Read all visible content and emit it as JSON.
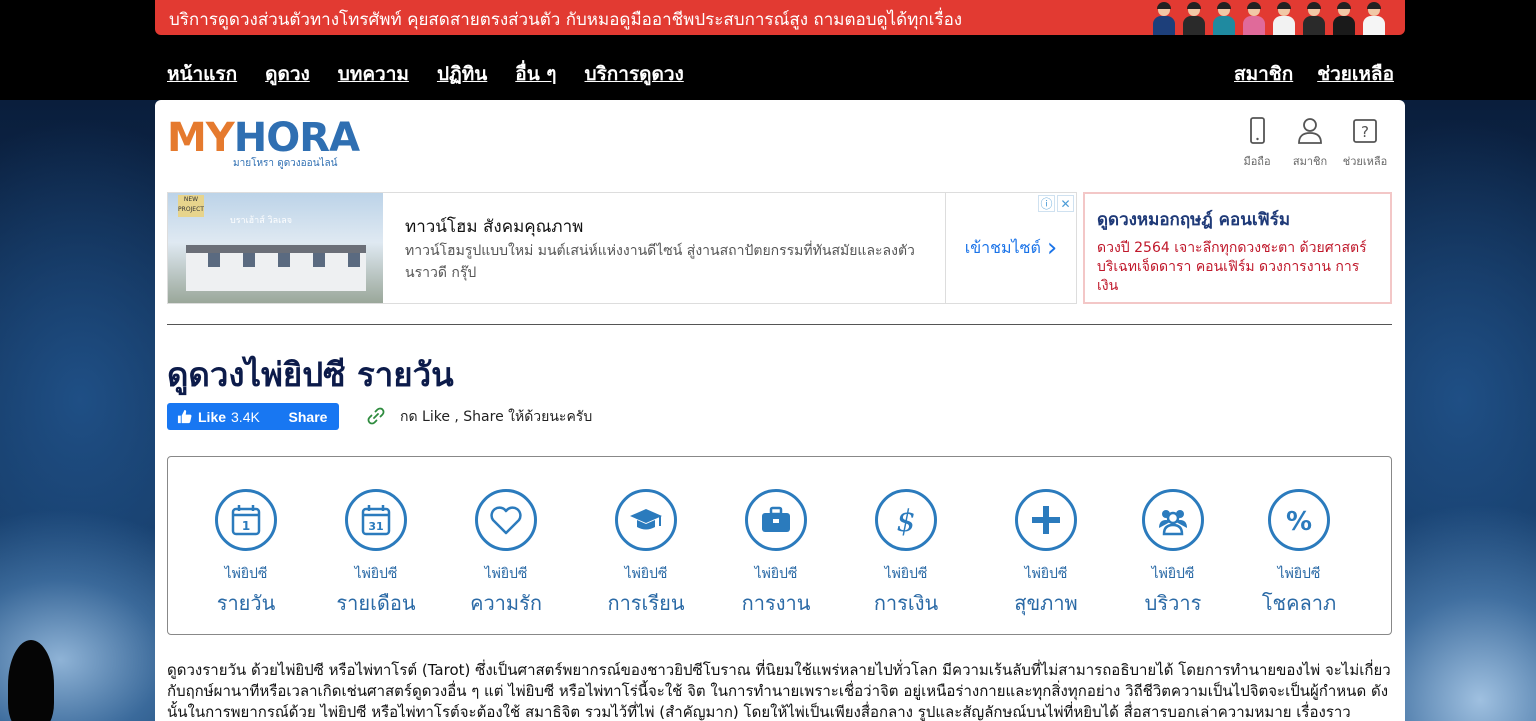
{
  "promo": {
    "text": "บริการดูดวงส่วนตัวทางโทรศัพท์ คุยสดสายตรงส่วนตัว กับหมอดูมืออาชีพประสบการณ์สูง ถามตอบดูได้ทุกเรื่อง",
    "accent": "#e23a32"
  },
  "nav": {
    "left": [
      "หน้าแรก",
      "ดูดวง",
      "บทความ",
      "ปฏิทิน",
      "อื่น ๆ",
      "บริการดูดวง"
    ],
    "right": [
      "สมาชิก",
      "ช่วยเหลือ"
    ]
  },
  "logo": {
    "my": "MY",
    "hora": "HORA",
    "sub": "มายโหรา ดูดวงออนไลน์"
  },
  "utility": {
    "mobile": "มือถือ",
    "member": "สมาชิก",
    "help": "ช่วยเหลือ"
  },
  "ad": {
    "thumb_badge": "NEW PROJECT",
    "thumb_title": "บราเฮ้าส์ วิลเลจ",
    "title": "ทาวน์โฮม สังคมคุณภาพ",
    "desc": "ทาวน์โฮมรูปแบบใหม่ มนต์เสน่ห์แห่งงานดีไซน์ สู่งานสถาปัตยกรรมที่ทันสมัยและลงตัว นราวดี กรุ๊ป",
    "cta": "เข้าชมไซต์",
    "cta_arrow": "›",
    "info": "ⓘ",
    "close": "✕"
  },
  "side_ad": {
    "title": "ดูดวงหมอกฤษฎ์ คอนเฟิร์ม",
    "desc": "ดวงปี 2564 เจาะลึกทุกดวงชะตา ด้วยศาสตร์บริเฉทเจ็ดดารา คอนเฟิร์ม ดวงการงาน การเงิน"
  },
  "page": {
    "title": "ดูดวงไพ่ยิปซี รายวัน",
    "like_label": "Like",
    "like_count": "3.4K",
    "share_label": "Share",
    "share_note": "กด Like , Share ให้ด้วยนะครับ"
  },
  "categories": [
    {
      "small": "ไพ่ยิปซี",
      "big": "รายวัน",
      "icon": "calendar-day-icon"
    },
    {
      "small": "ไพ่ยิปซี",
      "big": "รายเดือน",
      "icon": "calendar-month-icon"
    },
    {
      "small": "ไพ่ยิปซี",
      "big": "ความรัก",
      "icon": "heart-icon"
    },
    {
      "small": "ไพ่ยิปซี",
      "big": "การเรียน",
      "icon": "graduation-cap-icon"
    },
    {
      "small": "ไพ่ยิปซี",
      "big": "การงาน",
      "icon": "briefcase-icon"
    },
    {
      "small": "ไพ่ยิปซี",
      "big": "การเงิน",
      "icon": "dollar-icon"
    },
    {
      "small": "ไพ่ยิปซี",
      "big": "สุขภาพ",
      "icon": "plus-icon"
    },
    {
      "small": "ไพ่ยิปซี",
      "big": "บริวาร",
      "icon": "people-icon"
    },
    {
      "small": "ไพ่ยิปซี",
      "big": "โชคลาภ",
      "icon": "percent-icon"
    }
  ],
  "calendar_day_number": "1",
  "calendar_month_number": "31",
  "body": "ดูดวงรายวัน ด้วยไพ่ยิปซี หรือไพ่ทาโรต์ (Tarot) ซึ่งเป็นศาสตร์พยากรณ์ของชาวยิปซีโบราณ ที่นิยมใช้แพร่หลายไปทั่วโลก มีความเร้นลับที่ไม่สามารถอธิบายได้ โดยการทำนายของไพ่ จะไม่เกี่ยวกับฤกษ์ผานาทีหรือเวลาเกิดเช่นศาสตร์ดูดวงอื่น ๆ แต่ ไพ่ยิบซี หรือไพ่ทาโร่นี้จะใช้ จิต ในการทำนายเพราะเชื่อว่าจิต อยู่เหนือร่างกายและทุกสิ่งทุกอย่าง วิถีชีวิตความเป็นไปจิตจะเป็นผู้กำหนด ดังนั้นในการพยากรณ์ด้วย ไพ่ยิปซี หรือไพ่ทาโรต์จะต้องใช้ สมาธิจิต รวมไว้ที่ไพ่ (สำคัญมาก) โดยให้ไพ่เป็นเพียงสื่อกลาง รูปและสัญลักษณ์บนไพ่ที่หยิบได้ สื่อสารบอกเล่าความหมาย เรื่องราว"
}
